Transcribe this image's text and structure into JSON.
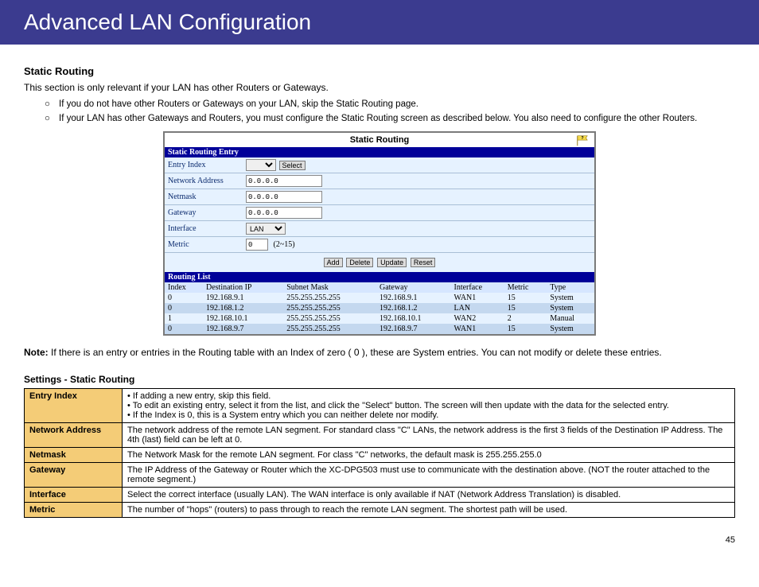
{
  "banner": {
    "title": "Advanced LAN Configuration"
  },
  "section": {
    "head": "Static Routing",
    "intro": "This section is only relevant if your LAN has other Routers or Gateways.",
    "bullets": [
      "If you do not have other Routers or Gateways on your LAN, skip the Static Routing page.",
      "If your LAN has other Gateways and Routers, you must configure the Static Routing screen as described below. You also need to configure the other Routers."
    ]
  },
  "embed": {
    "title": "Static Routing",
    "entry_head": "Static Routing Entry",
    "form": {
      "entry_index_label": "Entry Index",
      "entry_index_value": "",
      "select_btn": "Select",
      "netaddr_label": "Network Address",
      "netaddr_value": "0.0.0.0",
      "netmask_label": "Netmask",
      "netmask_value": "0.0.0.0",
      "gateway_label": "Gateway",
      "gateway_value": "0.0.0.0",
      "interface_label": "Interface",
      "interface_value": "LAN",
      "metric_label": "Metric",
      "metric_value": "0",
      "metric_hint": "(2~15)",
      "btn_add": "Add",
      "btn_delete": "Delete",
      "btn_update": "Update",
      "btn_reset": "Reset"
    },
    "list_head": "Routing List",
    "cols": {
      "index": "Index",
      "dest": "Destination IP",
      "mask": "Subnet Mask",
      "gw": "Gateway",
      "iface": "Interface",
      "metric": "Metric",
      "type": "Type"
    },
    "rows": [
      {
        "index": "0",
        "dest": "192.168.9.1",
        "mask": "255.255.255.255",
        "gw": "192.168.9.1",
        "iface": "WAN1",
        "metric": "15",
        "type": "System"
      },
      {
        "index": "0",
        "dest": "192.168.1.2",
        "mask": "255.255.255.255",
        "gw": "192.168.1.2",
        "iface": "LAN",
        "metric": "15",
        "type": "System"
      },
      {
        "index": "1",
        "dest": "192.168.10.1",
        "mask": "255.255.255.255",
        "gw": "192.168.10.1",
        "iface": "WAN2",
        "metric": "2",
        "type": "Manual"
      },
      {
        "index": "0",
        "dest": "192.168.9.7",
        "mask": "255.255.255.255",
        "gw": "192.168.9.7",
        "iface": "WAN1",
        "metric": "15",
        "type": "System"
      }
    ]
  },
  "note": {
    "prefix": "Note: ",
    "text": "If there is an entry or entries in the Routing table with an Index of zero ( 0 ), these are System entries. You can not modify or delete these entries."
  },
  "settings": {
    "head": "Settings - Static Routing",
    "rows": [
      {
        "lab": "Entry Index",
        "text": "• If adding a new entry, skip this field.\n• To edit an existing entry, select it from the list, and click the \"Select\" button. The screen will then update with the data for the selected entry.\n• If the Index is 0, this is a System entry which you can neither delete nor modify."
      },
      {
        "lab": "Network Address",
        "text": "The network address of the remote LAN segment. For standard class \"C\" LANs, the network address is the first 3 fields of the Destination IP Address. The 4th (last) field can be left at 0."
      },
      {
        "lab": "Netmask",
        "text": "The Network Mask for the remote LAN segment. For class \"C\" networks, the default mask is 255.255.255.0"
      },
      {
        "lab": "Gateway",
        "text": "The IP Address of the Gateway or Router which the XC-DPG503 must use to communicate with the destination above. (NOT the router attached to the remote segment.)"
      },
      {
        "lab": "Interface",
        "text": "Select the correct interface (usually LAN). The WAN interface is only available if NAT (Network Address Translation) is disabled."
      },
      {
        "lab": "Metric",
        "text": "The number of \"hops\" (routers) to pass through to reach the remote LAN segment. The shortest path will be used."
      }
    ]
  },
  "pagenum": "45"
}
